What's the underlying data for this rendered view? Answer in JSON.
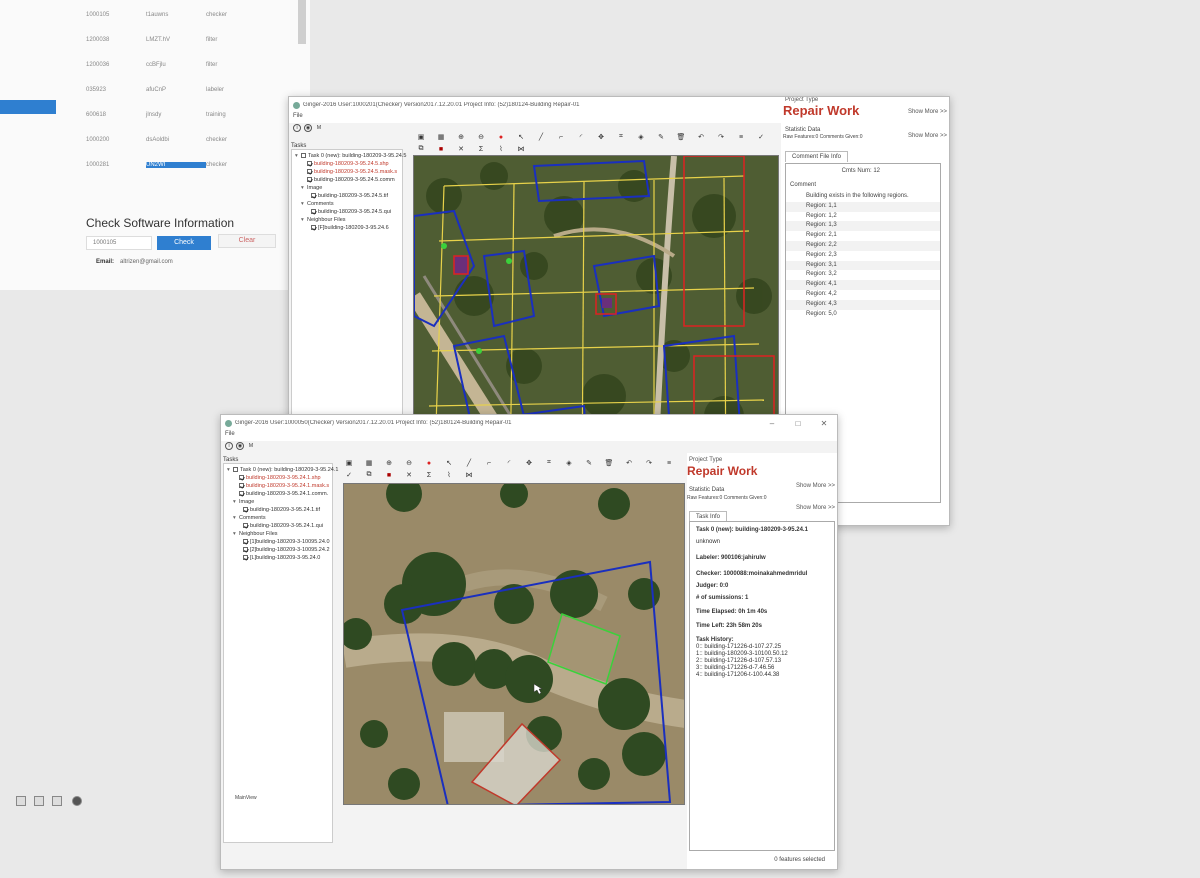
{
  "background_page": {
    "rows": [
      {
        "id": "1000105",
        "user": "t1auwns",
        "role": "checker"
      },
      {
        "id": "1200038",
        "user": "LMZT.hV",
        "role": "filter"
      },
      {
        "id": "1200036",
        "user": "ccBFjlu",
        "role": "filter"
      },
      {
        "id": "035923",
        "user": "afuCnP",
        "role": "labeler"
      },
      {
        "id": "600618",
        "user": "jlnsdy",
        "role": "training"
      },
      {
        "id": "1000200",
        "user": "dsAoldbi",
        "role": "checker"
      },
      {
        "id": "1000281",
        "user": "UN2WI",
        "role": "checker"
      }
    ],
    "check_title": "Check Software Information",
    "check_input_value": "1000105",
    "check_button": "Check",
    "clear_button": "Clear",
    "email_label": "Email:",
    "email_value": "altrizen@gmail.com"
  },
  "window_back": {
    "title": "Ginger-2016   User:1000201(Checker)   Version2017.12.20.01   Project Info: (52)180124-Building Repair-01",
    "menu_file": "File",
    "mini_tools": [
      "i",
      "◉",
      "M"
    ],
    "tasks_label": "Tasks",
    "tree": {
      "task": "Task 0 (new): building-180209-3-95.24.5",
      "files": [
        "building-180209-3-95.24.5.shp",
        "building-180209-3-95.24.5.mask.s",
        "building-180209-3-95.24.5.comm"
      ],
      "image_label": "Image",
      "image_file": "building-180209-3-95.24.5.tif",
      "comments_label": "Comments",
      "comment_file": "building-180209-3-95.24.5.qui",
      "neighbour_label": "Neighbour Files",
      "neighbour_files": [
        "[F]building-180209-3-95.24.6"
      ]
    },
    "project_type_label": "Project Type",
    "project_type": "Repair Work",
    "show_more": "Show More >>",
    "statistic_label": "Statistic Data",
    "statistic_value": "Raw Features:0 Comments Given:0",
    "tab_comment": "Comment File Info",
    "cmts_num": "Cmts Num:  12",
    "comment_heading": "Comment",
    "comment_intro": "Building exists in the following regions.",
    "regions": [
      "Region: 1,1",
      "Region: 1,2",
      "Region: 1,3",
      "Region: 2,1",
      "Region: 2,2",
      "Region: 2,3",
      "Region: 3,1",
      "Region: 3,2",
      "Region: 4,1",
      "Region: 4,2",
      "Region: 4,3",
      "Region: 5,0"
    ]
  },
  "window_front": {
    "title": "Ginger-2016   User:1000050(Checker)   Version2017.12.20.01   Project Info: (52)180124-Building Repair-01",
    "menu_file": "File",
    "mini_tools": [
      "i",
      "◉",
      "M"
    ],
    "tasks_label": "Tasks",
    "tree": {
      "task": "Task 0 (new): building-180209-3-95.24.1",
      "files": [
        "building-180209-3-95.24.1.shp",
        "building-180209-3-95.24.1.mask.s",
        "building-180209-3-95.24.1.comm."
      ],
      "image_label": "Image",
      "image_file": "building-180209-3-95.24.1.tif",
      "comments_label": "Comments",
      "comment_file": "building-180209-3-95.24.1.qui",
      "neighbour_label": "Neighbour Files",
      "neighbour_files": [
        "[1]building-180209-3-10095.24.0",
        "[2]building-180209-3-10095.24.2",
        "[L]building-180209-3-95.24.0"
      ]
    },
    "main_view_label": "MainView",
    "project_type_label": "Project Type",
    "project_type": "Repair Work",
    "show_more": "Show More >>",
    "statistic_label": "Statistic Data",
    "statistic_value": "Raw Features:0 Comments Given:0",
    "tab_task": "Task Info",
    "task_info": {
      "task": "Task 0 (new): building-180209-3-95.24.1",
      "status": "unknown",
      "labeler": "Labeler: 900106:jahirulw",
      "checker": "Checker: 1000088:moinakahmedmridul",
      "judger": "Judger: 0:0",
      "submissions": "# of sumissions: 1",
      "elapsed": "Time Elapsed: 0h 1m 40s",
      "left": "Time Left: 23h 58m 20s",
      "history_label": "Task History:",
      "history": [
        "0:: building-171226-d-107.27.25",
        "1:: building-180209-3-10100.50.12",
        "2:: building-171226-d-107.57.13",
        "3:: building-171226-d-7.46.56",
        "4:: building-171206-t-100.44.38"
      ]
    },
    "status_bar": "0 features selected"
  },
  "colors": {
    "accent_red": "#c0392b",
    "accent_blue": "#2f7fd0",
    "poly_blue": "#1a2fbf",
    "grid_yellow": "#e8d24a",
    "poly_green": "#3bd13b"
  }
}
